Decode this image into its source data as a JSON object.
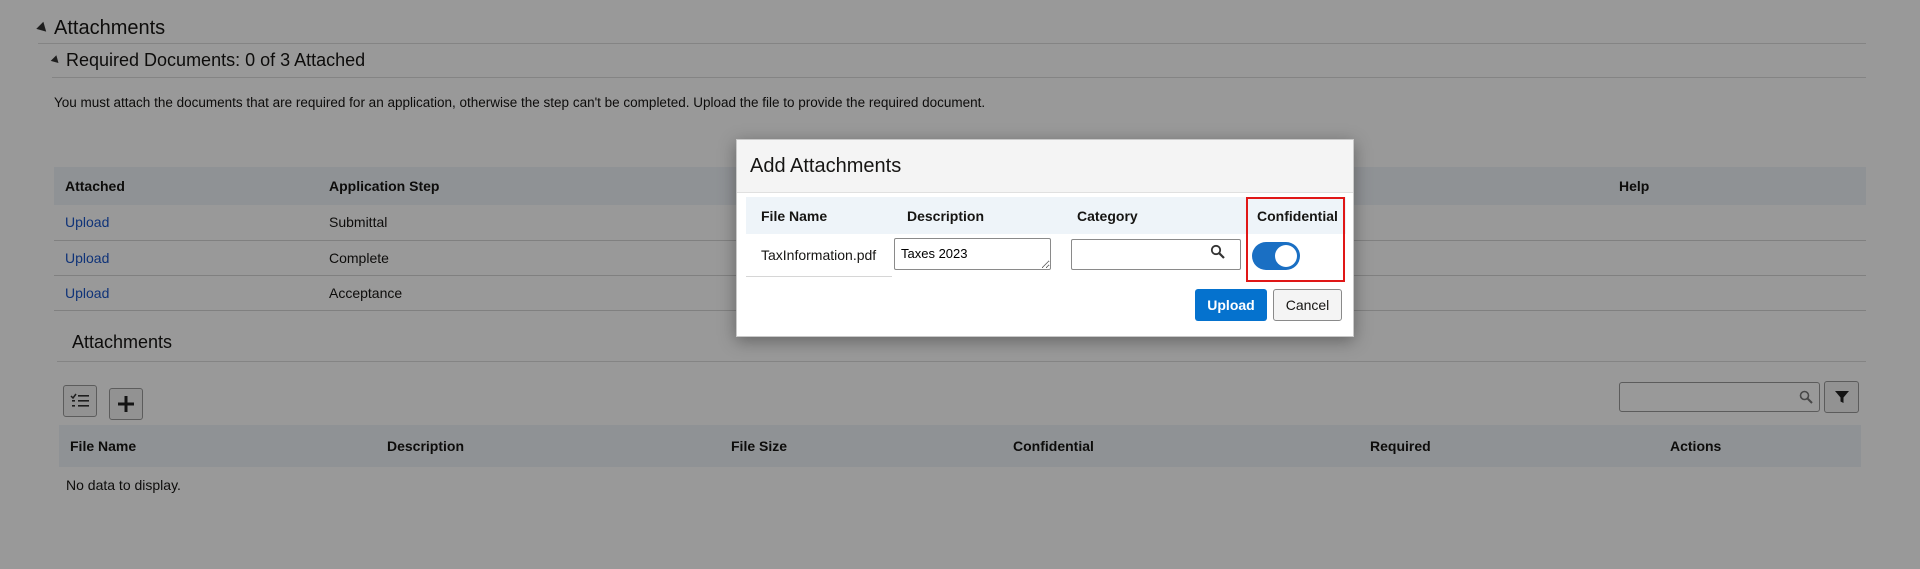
{
  "page": {
    "section_title": "Attachments",
    "required_title": "Required Documents: 0 of 3 Attached",
    "info_text": "You must attach the documents that are required for an application, otherwise the step can't be completed. Upload the file to provide the required document."
  },
  "required_table": {
    "headers": [
      "Attached",
      "Application Step",
      "Help"
    ],
    "rows": [
      {
        "link": "Upload",
        "step": "Submittal"
      },
      {
        "link": "Upload",
        "step": "Complete"
      },
      {
        "link": "Upload",
        "step": "Acceptance"
      }
    ]
  },
  "attachments": {
    "title": "Attachments",
    "headers": [
      "File Name",
      "Description",
      "File Size",
      "Confidential",
      "Required",
      "Actions"
    ],
    "empty_text": "No data to display.",
    "icons": {
      "list": "checklist-icon",
      "add": "plus-icon",
      "search": "search-icon",
      "filter": "filter-icon"
    }
  },
  "dialog": {
    "title": "Add Attachments",
    "headers": [
      "File Name",
      "Description",
      "Category",
      "Confidential"
    ],
    "file_name": "TaxInformation.pdf",
    "description_value": "Taxes 2023",
    "category_value": "",
    "confidential_on": true,
    "upload_label": "Upload",
    "cancel_label": "Cancel"
  },
  "colors": {
    "primary": "#0572ce",
    "toggle_on": "#1a6fc3",
    "highlight": "#e01717",
    "link": "#1a55c9",
    "header_bg": "#eef4f9"
  }
}
